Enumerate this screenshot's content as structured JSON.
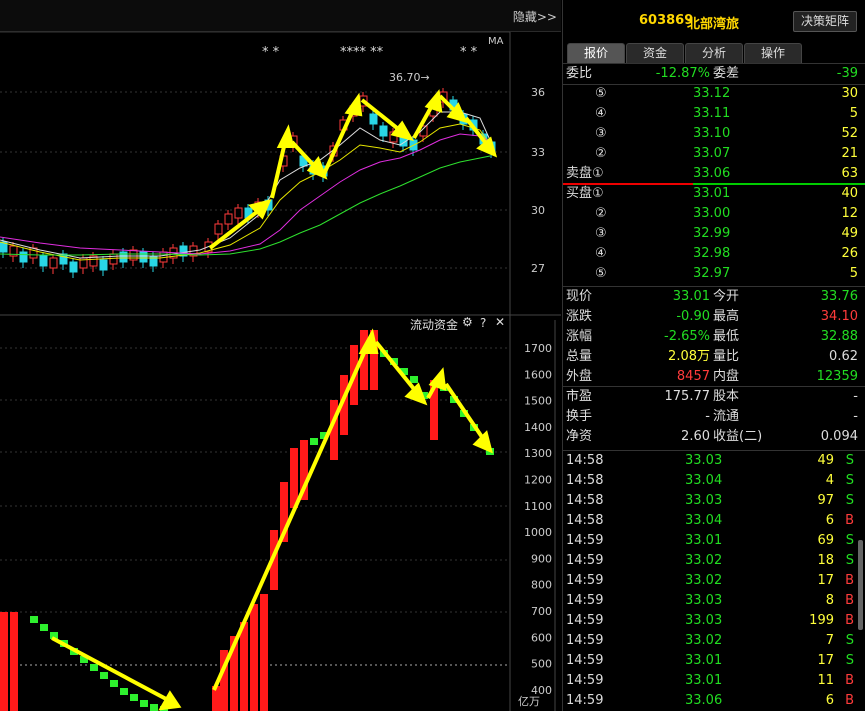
{
  "left": {
    "hide_label": "隐藏>>",
    "ma_label": "MA",
    "price_peak_label": "36.70→",
    "stars": [
      "* *",
      "**** **",
      "* *"
    ],
    "price_axis": [
      "36",
      "33",
      "30",
      "27"
    ],
    "fund_title": "流动资金",
    "fund_axis": [
      "1700",
      "1600",
      "1500",
      "1400",
      "1300",
      "1200",
      "1100",
      "1000",
      "900",
      "800",
      "700",
      "600",
      "500",
      "400"
    ],
    "fund_unit": "亿万"
  },
  "header": {
    "code": "603869",
    "name": "北部湾旅",
    "decision_button": "决策矩阵"
  },
  "tabs": [
    "报价",
    "资金",
    "分析",
    "操作"
  ],
  "weibi": {
    "label1": "委比",
    "value1": "-12.87%",
    "label2": "委差",
    "value2": "-39"
  },
  "sell_book": [
    {
      "label": "⑤",
      "price": "33.12",
      "vol": "30"
    },
    {
      "label": "④",
      "price": "33.11",
      "vol": "5"
    },
    {
      "label": "③",
      "price": "33.10",
      "vol": "52"
    },
    {
      "label": "②",
      "price": "33.07",
      "vol": "21"
    },
    {
      "label": "卖盘①",
      "price": "33.06",
      "vol": "63"
    }
  ],
  "buy_book": [
    {
      "label": "买盘①",
      "price": "33.01",
      "vol": "40"
    },
    {
      "label": "②",
      "price": "33.00",
      "vol": "12"
    },
    {
      "label": "③",
      "price": "32.99",
      "vol": "49"
    },
    {
      "label": "④",
      "price": "32.98",
      "vol": "26"
    },
    {
      "label": "⑤",
      "price": "32.97",
      "vol": "5"
    }
  ],
  "quote": [
    {
      "l1": "现价",
      "v1": "33.01",
      "c1": "g",
      "l2": "今开",
      "v2": "33.76",
      "c2": "g"
    },
    {
      "l1": "涨跌",
      "v1": "-0.90",
      "c1": "g",
      "l2": "最高",
      "v2": "34.10",
      "c2": "r"
    },
    {
      "l1": "涨幅",
      "v1": "-2.65%",
      "c1": "g",
      "l2": "最低",
      "v2": "32.88",
      "c2": "g"
    },
    {
      "l1": "总量",
      "v1": "2.08万",
      "c1": "y",
      "l2": "量比",
      "v2": "0.62",
      "c2": "w"
    },
    {
      "l1": "外盘",
      "v1": "8457",
      "c1": "r",
      "l2": "内盘",
      "v2": "12359",
      "c2": "g"
    }
  ],
  "fundamentals": [
    {
      "l1": "市盈",
      "v1": "175.77",
      "l2": "股本",
      "v2": "-"
    },
    {
      "l1": "换手",
      "v1": "-",
      "l2": "流通",
      "v2": "-"
    },
    {
      "l1": "净资",
      "v1": "2.60",
      "l2": "收益(二)",
      "v2": "0.094"
    }
  ],
  "ticks": [
    {
      "time": "14:58",
      "price": "33.03",
      "vol": "49",
      "side": "S"
    },
    {
      "time": "14:58",
      "price": "33.04",
      "vol": "4",
      "side": "S"
    },
    {
      "time": "14:58",
      "price": "33.03",
      "vol": "97",
      "side": "S"
    },
    {
      "time": "14:58",
      "price": "33.04",
      "vol": "6",
      "side": "B"
    },
    {
      "time": "14:59",
      "price": "33.01",
      "vol": "69",
      "side": "S"
    },
    {
      "time": "14:59",
      "price": "33.02",
      "vol": "18",
      "side": "S"
    },
    {
      "time": "14:59",
      "price": "33.02",
      "vol": "17",
      "side": "B"
    },
    {
      "time": "14:59",
      "price": "33.03",
      "vol": "8",
      "side": "B"
    },
    {
      "time": "14:59",
      "price": "33.03",
      "vol": "199",
      "side": "B"
    },
    {
      "time": "14:59",
      "price": "33.02",
      "vol": "7",
      "side": "S"
    },
    {
      "time": "14:59",
      "price": "33.01",
      "vol": "17",
      "side": "S"
    },
    {
      "time": "14:59",
      "price": "33.01",
      "vol": "11",
      "side": "B"
    },
    {
      "time": "14:59",
      "price": "33.06",
      "vol": "6",
      "side": "B"
    }
  ]
}
